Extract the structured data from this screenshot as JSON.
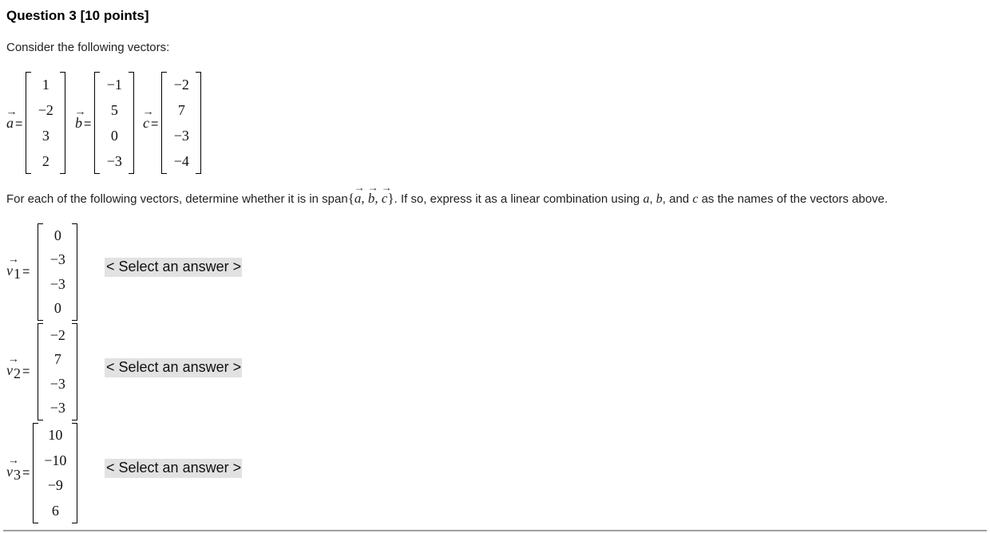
{
  "question": {
    "title": "Question 3 [10 points]",
    "intro": "Consider the following vectors:"
  },
  "given_vectors": [
    {
      "name": "a",
      "components": [
        "1",
        "−2",
        "3",
        "2"
      ]
    },
    {
      "name": "b",
      "components": [
        "−1",
        "5",
        "0",
        "−3"
      ]
    },
    {
      "name": "c",
      "components": [
        "−2",
        "7",
        "−3",
        "−4"
      ]
    }
  ],
  "symbols": {
    "equals": "=",
    "arrow": "→",
    "comma": ",",
    "open_brace": "{",
    "close_brace": "}"
  },
  "prompt": {
    "part1": "For each of the following vectors, determine whether it is in span",
    "part2": ". If so, express it as a linear combination using ",
    "name_a": "a",
    "sep1": ", ",
    "name_b": "b",
    "sep2": ", and ",
    "name_c": "c",
    "part3": " as the names of the vectors above."
  },
  "test_vectors": [
    {
      "name": "v",
      "subscript": "1",
      "components": [
        "0",
        "−3",
        "−3",
        "0"
      ],
      "answer": "< Select an answer >"
    },
    {
      "name": "v",
      "subscript": "2",
      "components": [
        "−2",
        "7",
        "−3",
        "−3"
      ],
      "answer": "< Select an answer >"
    },
    {
      "name": "v",
      "subscript": "3",
      "components": [
        "10",
        "−10",
        "−9",
        "6"
      ],
      "answer": "< Select an answer >"
    }
  ]
}
